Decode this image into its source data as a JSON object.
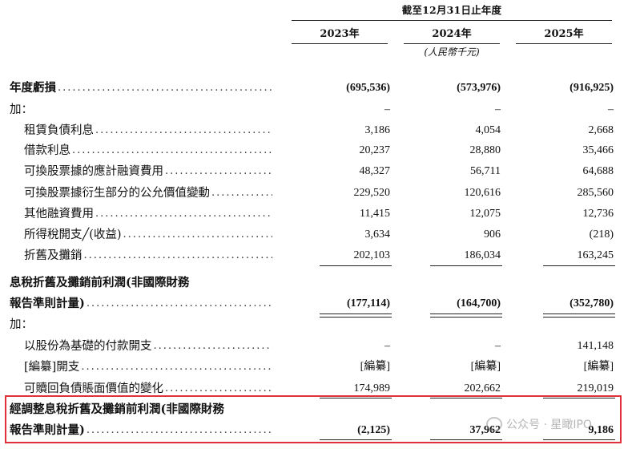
{
  "header": {
    "period": "截至12月31日止年度",
    "years": [
      "2023年",
      "2024年",
      "2025年"
    ],
    "unit": "(人民幣千元)"
  },
  "rows": [
    {
      "label": "年度虧損",
      "bold": true,
      "indent": 0,
      "dots": true,
      "values": [
        "(695,536)",
        "(573,976)",
        "(916,925)"
      ]
    },
    {
      "label": "加：",
      "bold": false,
      "indent": 1,
      "dots": false,
      "values": [
        "–",
        "–",
        "–"
      ]
    },
    {
      "label": "租賃負債利息",
      "bold": false,
      "indent": 2,
      "dots": true,
      "values": [
        "3,186",
        "4,054",
        "2,668"
      ]
    },
    {
      "label": "借款利息",
      "bold": false,
      "indent": 2,
      "dots": true,
      "values": [
        "20,237",
        "28,880",
        "35,466"
      ]
    },
    {
      "label": "可換股票據的應計融資費用",
      "bold": false,
      "indent": 2,
      "dots": true,
      "values": [
        "48,327",
        "56,711",
        "64,688"
      ]
    },
    {
      "label": "可換股票據衍生部分的公允價值變動",
      "bold": false,
      "indent": 2,
      "dots": true,
      "values": [
        "229,520",
        "120,616",
        "285,560"
      ]
    },
    {
      "label": "其他融資費用",
      "bold": false,
      "indent": 2,
      "dots": true,
      "values": [
        "11,415",
        "12,075",
        "12,736"
      ]
    },
    {
      "label": "所得稅開支╱(收益)",
      "bold": false,
      "indent": 2,
      "dots": true,
      "values": [
        "3,634",
        "906",
        "(218)"
      ]
    },
    {
      "label": "折舊及攤銷",
      "bold": false,
      "indent": 2,
      "dots": true,
      "values": [
        "202,103",
        "186,034",
        "163,245"
      ]
    },
    {
      "label": "息稅折舊及攤銷前利潤(非國際財務",
      "bold": true,
      "indent": 0,
      "dots": false,
      "values": [
        "",
        "",
        ""
      ]
    },
    {
      "label": "報告準則計量)",
      "bold": true,
      "indent": 1,
      "dots": true,
      "values": [
        "(177,114)",
        "(164,700)",
        "(352,780)"
      ]
    },
    {
      "label": "加：",
      "bold": false,
      "indent": 1,
      "dots": false,
      "values": [
        "",
        "",
        ""
      ]
    },
    {
      "label": "以股份為基礎的付款開支",
      "bold": false,
      "indent": 2,
      "dots": true,
      "values": [
        "–",
        "–",
        "141,148"
      ]
    },
    {
      "label": "[編纂]開支",
      "bold": false,
      "indent": 2,
      "dots": true,
      "values": [
        "[編纂]",
        "[編纂]",
        "[編纂]"
      ]
    },
    {
      "label": "可贖回負債賬面價值的變化",
      "bold": false,
      "indent": 2,
      "dots": true,
      "values": [
        "174,989",
        "202,662",
        "219,019"
      ]
    },
    {
      "label": "經調整息稅折舊及攤銷前利潤(非國際財務",
      "bold": true,
      "indent": 0,
      "dots": false,
      "values": [
        "",
        "",
        ""
      ]
    },
    {
      "label": "報告準則計量)",
      "bold": true,
      "indent": 1,
      "dots": true,
      "values": [
        "(2,125)",
        "37,962",
        "9,186"
      ]
    }
  ],
  "watermark": {
    "text": "公众号 · 星瞰IPO",
    "icon": "wechat-icon"
  },
  "colors": {
    "highlight_border": "#e0313a"
  }
}
